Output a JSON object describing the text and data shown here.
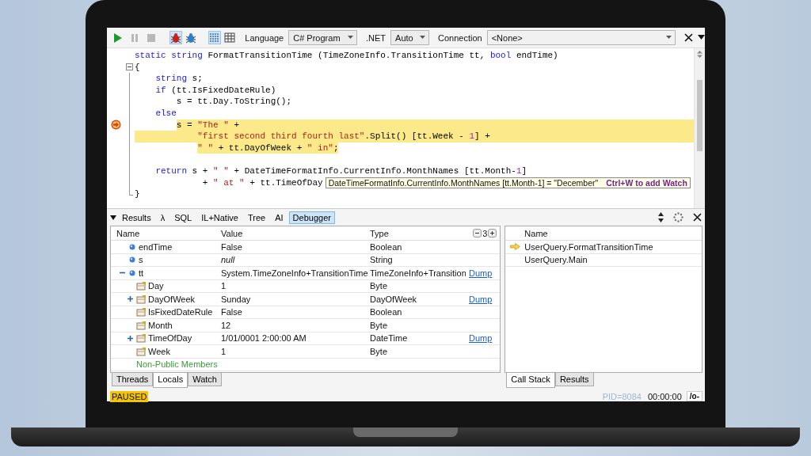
{
  "toolbar": {
    "run_buttons": [
      {
        "kind": "run",
        "disabled": false
      },
      {
        "kind": "pause",
        "disabled": true
      },
      {
        "kind": "stop",
        "disabled": true
      }
    ],
    "debug_buttons": [
      {
        "kind": "bug",
        "selected": true
      },
      {
        "kind": "bug_step",
        "selected": false
      }
    ],
    "view_buttons": [
      {
        "kind": "rich",
        "selected": true
      },
      {
        "kind": "grid",
        "selected": false
      }
    ],
    "language_label": "Language",
    "language": "C# Program",
    "net_label": ".NET",
    "net": "Auto",
    "connection_label": "Connection",
    "connection": "<None>"
  },
  "editor": {
    "lines": [
      {
        "kind": "code",
        "segments": [
          {
            "kind": "keyword",
            "text": "static string"
          },
          {
            "kind": "plain",
            "text": " FormatTransitionTime (TimeZoneInfo.TransitionTime tt, "
          },
          {
            "kind": "keyword",
            "text": "bool"
          },
          {
            "kind": "plain",
            "text": " endTime)"
          }
        ],
        "highlighted": false,
        "current": false
      },
      {
        "kind": "code",
        "segments": [
          {
            "kind": "plain",
            "text": "{"
          }
        ],
        "highlighted": false,
        "current": false,
        "fold": true
      },
      {
        "kind": "code",
        "segments": [
          {
            "kind": "keyword",
            "text": "    string"
          },
          {
            "kind": "plain",
            "text": " s;"
          }
        ],
        "highlighted": false,
        "current": false
      },
      {
        "kind": "code",
        "segments": [
          {
            "kind": "keyword",
            "text": "    if"
          },
          {
            "kind": "plain",
            "text": " (tt.IsFixedDateRule)"
          }
        ],
        "highlighted": false,
        "current": false
      },
      {
        "kind": "code",
        "segments": [
          {
            "kind": "plain",
            "text": "        s = tt.Day.ToString();"
          }
        ],
        "highlighted": false,
        "current": false
      },
      {
        "kind": "code",
        "segments": [
          {
            "kind": "keyword",
            "text": "    else"
          }
        ],
        "highlighted": false,
        "current": false
      },
      {
        "kind": "code",
        "segments": [
          {
            "kind": "plain",
            "text": "        s = "
          },
          {
            "kind": "string",
            "text": "\"The \""
          },
          {
            "kind": "plain",
            "text": " +"
          }
        ],
        "highlighted": true,
        "current": true
      },
      {
        "kind": "code",
        "segments": [
          {
            "kind": "string",
            "text": "            \"first second third fourth last\""
          },
          {
            "kind": "plain",
            "text": ".Split() [tt.Week - "
          },
          {
            "kind": "number",
            "text": "1"
          },
          {
            "kind": "plain",
            "text": "] +"
          }
        ],
        "highlighted": true,
        "current": false
      },
      {
        "kind": "code",
        "segments": [
          {
            "kind": "string",
            "text": "            \" \""
          },
          {
            "kind": "plain",
            "text": " + tt.DayOfWeek + "
          },
          {
            "kind": "string",
            "text": "\" in\""
          },
          {
            "kind": "plain",
            "text": ";"
          }
        ],
        "highlighted": true,
        "current": false
      },
      {
        "kind": "blank"
      },
      {
        "kind": "code",
        "segments": [
          {
            "kind": "keyword",
            "text": "    return"
          },
          {
            "kind": "plain",
            "text": " s + "
          },
          {
            "kind": "string",
            "text": "\" \""
          },
          {
            "kind": "plain",
            "text": " + DateTimeFormatInfo.CurrentInfo.MonthNames [tt.Month-"
          },
          {
            "kind": "number",
            "text": "1"
          },
          {
            "kind": "plain",
            "text": "]"
          }
        ],
        "highlighted": false,
        "current": false
      },
      {
        "kind": "code",
        "segments": [
          {
            "kind": "plain",
            "text": "             + "
          },
          {
            "kind": "string",
            "text": "\" at \""
          },
          {
            "kind": "plain",
            "text": " + tt.TimeOfDay"
          }
        ],
        "highlighted": false,
        "current": false,
        "tooltip": {
          "expression": "DateTimeFormatInfo.CurrentInfo.MonthNames [tt.Month-1] = \"December\"",
          "hint": "Ctrl+W to add Watch"
        }
      },
      {
        "kind": "code",
        "segments": [
          {
            "kind": "plain",
            "text": "}"
          }
        ],
        "highlighted": false,
        "current": false
      }
    ]
  },
  "output_tabs": [
    {
      "label": "Results",
      "selected": false
    },
    {
      "label": "λ",
      "selected": false
    },
    {
      "label": "SQL",
      "selected": false
    },
    {
      "label": "IL+Native",
      "selected": false
    },
    {
      "label": "Tree",
      "selected": false
    },
    {
      "label": "AI",
      "selected": false
    },
    {
      "label": "Debugger",
      "selected": true
    }
  ],
  "locals": {
    "columns": [
      "Name",
      "Value",
      "Type"
    ],
    "depth": "3",
    "rows": [
      {
        "kind": "field",
        "name": "endTime",
        "value": "False",
        "type": "Boolean"
      },
      {
        "kind": "field",
        "name": "s",
        "value": "null",
        "is_null": true,
        "type": "String"
      },
      {
        "kind": "field",
        "name": "tt",
        "value": "System.TimeZoneInfo+TransitionTime",
        "type": "TimeZoneInfo+Transition",
        "dump": "Dump",
        "expanded": true,
        "children": [
          {
            "kind": "property",
            "name": "Day",
            "value": "1",
            "type": "Byte"
          },
          {
            "kind": "property",
            "name": "DayOfWeek",
            "value": "Sunday",
            "type": "DayOfWeek",
            "dump": "Dump",
            "expanded": false
          },
          {
            "kind": "property",
            "name": "IsFixedDateRule",
            "value": "False",
            "type": "Boolean"
          },
          {
            "kind": "property",
            "name": "Month",
            "value": "12",
            "type": "Byte"
          },
          {
            "kind": "property",
            "name": "TimeOfDay",
            "value": "1/01/0001 2:00:00 AM",
            "type": "DateTime",
            "dump": "Dump",
            "expanded": false
          },
          {
            "kind": "property",
            "name": "Week",
            "value": "1",
            "type": "Byte"
          },
          {
            "kind": "group",
            "name": "Non-Public Members"
          }
        ]
      }
    ]
  },
  "locals_tabs": [
    {
      "label": "Threads",
      "selected": false
    },
    {
      "label": "Locals",
      "selected": true
    },
    {
      "label": "Watch",
      "selected": false
    }
  ],
  "state_badge": "PAUSED",
  "call_stack": {
    "columns": [
      "Name"
    ],
    "rows": [
      {
        "name": "UserQuery.FormatTransitionTime",
        "current": true
      },
      {
        "name": "UserQuery.Main",
        "current": false
      }
    ]
  },
  "call_stack_tabs": [
    {
      "label": "Call Stack",
      "selected": true
    },
    {
      "label": "Results",
      "selected": false
    }
  ],
  "status": {
    "pid": "PID=8084",
    "time": "00:00:00",
    "button": "/o-"
  }
}
